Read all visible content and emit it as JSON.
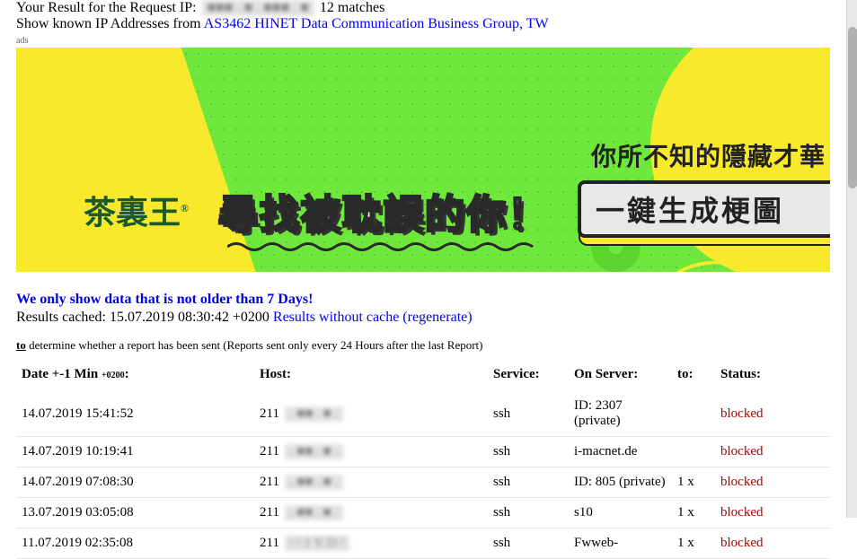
{
  "header": {
    "result_prefix": "Your Result for the Request IP: ",
    "ip_masked": "■■■ . ■ . ■■■ . ■",
    "matches": " 12 matches",
    "show_prefix": "Show known IP Addresses from ",
    "as_link": "AS3462 HINET Data Communication Business Group, TW"
  },
  "ads_label": "ads",
  "banner": {
    "brand": "茶裏王",
    "reg": "®",
    "main": "尋找被耽誤的你！",
    "sub": "你所不知的隱藏才華",
    "cta": "一鍵生成梗圖"
  },
  "notice": "We only show data that is not older than 7 Days!",
  "cache": {
    "prefix": "Results cached: ",
    "ts": "15.07.2019 08:30:42 +0200 ",
    "regen": "Results without cache (regenerate)"
  },
  "small_note": {
    "to": "to",
    "rest": " determine whether a report has been sent (Reports sent only every 24 Hours after the last Report)"
  },
  "columns": {
    "date": "Date +-1 Min ",
    "date_tz": "+0200",
    "date_colon": ":",
    "host": "Host:",
    "service": "Service:",
    "server": "On Server:",
    "to": "to:",
    "status": "Status:"
  },
  "rows": [
    {
      "date": "14.07.2019 15:41:52",
      "host_pre": "211",
      "host_blur": ". ■■ . ■ .",
      "service": "ssh",
      "server": "ID: 2307 (private)",
      "to": "",
      "status": "blocked"
    },
    {
      "date": "14.07.2019 10:19:41",
      "host_pre": "211",
      "host_blur": ". ■■ . ■ .",
      "service": "ssh",
      "server": "i-macnet.de",
      "to": "",
      "status": "blocked"
    },
    {
      "date": "14.07.2019 07:08:30",
      "host_pre": "211",
      "host_blur": ". ■■ . ■ .",
      "service": "ssh",
      "server": "ID: 805 (private)",
      "to": "1 x",
      "status": "blocked"
    },
    {
      "date": "13.07.2019 03:05:08",
      "host_pre": "211",
      "host_blur": ". ■■ . ■ .",
      "service": "ssh",
      "server": "s10",
      "to": "1 x",
      "status": "blocked"
    },
    {
      "date": "11.07.2019 02:35:08",
      "host_pre": "211",
      "host_blur": "/ / 1 V D /",
      "service": "ssh",
      "server": "Fwweb-",
      "to": "1 x",
      "status": "blocked"
    }
  ]
}
